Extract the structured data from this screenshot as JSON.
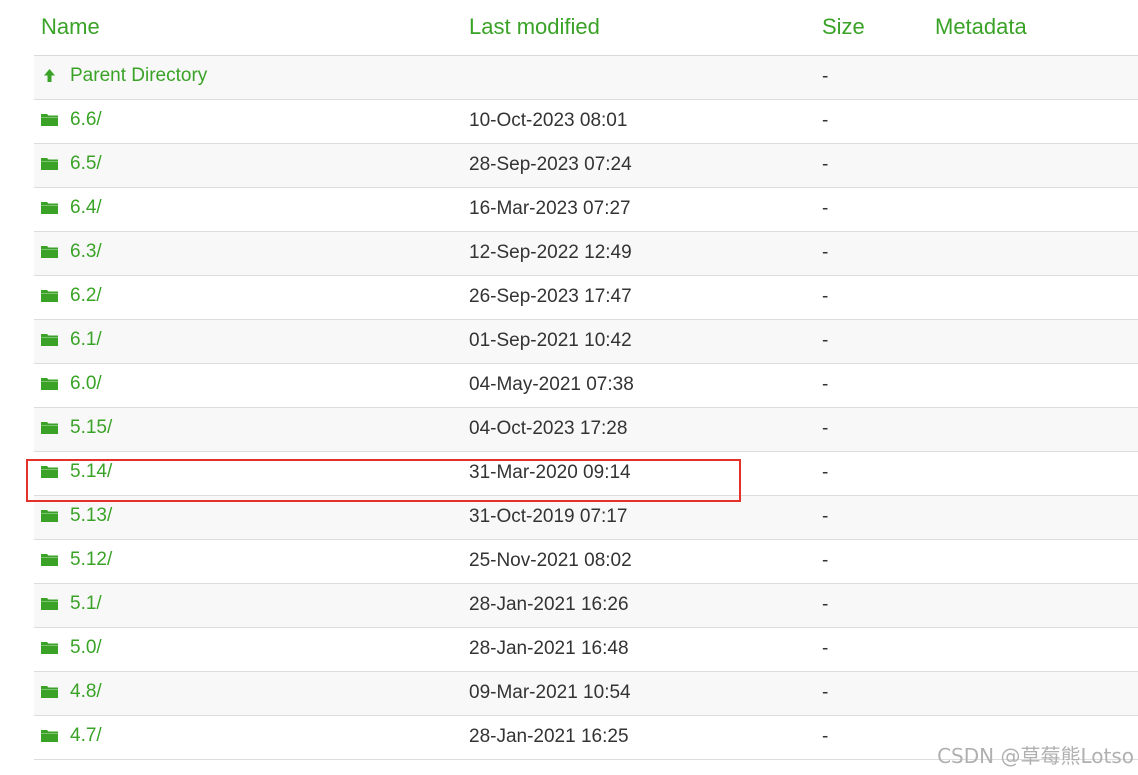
{
  "columns": {
    "name": "Name",
    "last_modified": "Last modified",
    "size": "Size",
    "metadata": "Metadata"
  },
  "colors": {
    "link": "#3aa327",
    "highlight": "#e4322b"
  },
  "parent": {
    "label": "Parent Directory",
    "size": "-",
    "icon": "up-arrow-icon"
  },
  "rows": [
    {
      "name": "6.6/",
      "modified": "10-Oct-2023 08:01",
      "size": "-",
      "icon": "folder-icon"
    },
    {
      "name": "6.5/",
      "modified": "28-Sep-2023 07:24",
      "size": "-",
      "icon": "folder-icon"
    },
    {
      "name": "6.4/",
      "modified": "16-Mar-2023 07:27",
      "size": "-",
      "icon": "folder-icon"
    },
    {
      "name": "6.3/",
      "modified": "12-Sep-2022 12:49",
      "size": "-",
      "icon": "folder-icon"
    },
    {
      "name": "6.2/",
      "modified": "26-Sep-2023 17:47",
      "size": "-",
      "icon": "folder-icon"
    },
    {
      "name": "6.1/",
      "modified": "01-Sep-2021 10:42",
      "size": "-",
      "icon": "folder-icon"
    },
    {
      "name": "6.0/",
      "modified": "04-May-2021 07:38",
      "size": "-",
      "icon": "folder-icon"
    },
    {
      "name": "5.15/",
      "modified": "04-Oct-2023 17:28",
      "size": "-",
      "icon": "folder-icon"
    },
    {
      "name": "5.14/",
      "modified": "31-Mar-2020 09:14",
      "size": "-",
      "icon": "folder-icon",
      "highlighted": true
    },
    {
      "name": "5.13/",
      "modified": "31-Oct-2019 07:17",
      "size": "-",
      "icon": "folder-icon"
    },
    {
      "name": "5.12/",
      "modified": "25-Nov-2021 08:02",
      "size": "-",
      "icon": "folder-icon"
    },
    {
      "name": "5.1/",
      "modified": "28-Jan-2021 16:26",
      "size": "-",
      "icon": "folder-icon"
    },
    {
      "name": "5.0/",
      "modified": "28-Jan-2021 16:48",
      "size": "-",
      "icon": "folder-icon"
    },
    {
      "name": "4.8/",
      "modified": "09-Mar-2021 10:54",
      "size": "-",
      "icon": "folder-icon"
    },
    {
      "name": "4.7/",
      "modified": "28-Jan-2021 16:25",
      "size": "-",
      "icon": "folder-icon"
    }
  ],
  "watermark": "CSDN @草莓熊Lotso"
}
